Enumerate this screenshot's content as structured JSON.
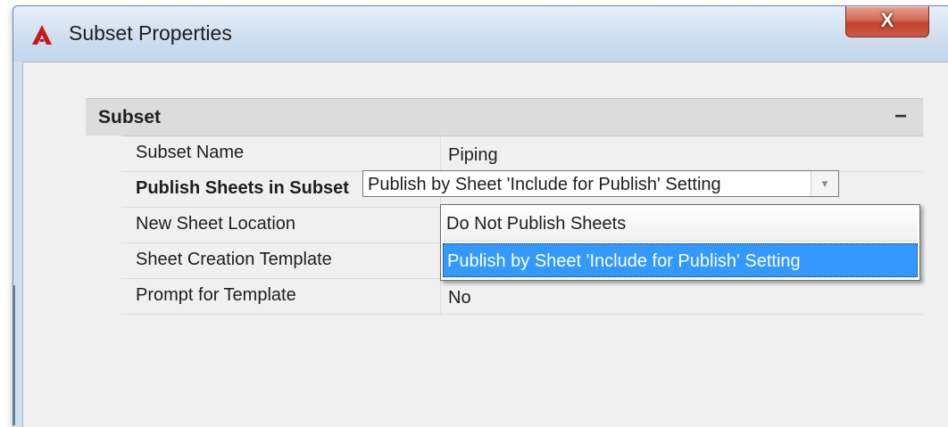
{
  "window": {
    "title": "Subset Properties",
    "app_icon": "autocad-a-icon",
    "close_label": "X"
  },
  "grid": {
    "category": "Subset",
    "collapse_symbol": "−",
    "properties": [
      {
        "name": "Subset Name",
        "value": "Piping"
      },
      {
        "name": "Publish Sheets in Subset",
        "value": "Publish by Sheet 'Include for Publish' Setting"
      },
      {
        "name": "New Sheet Location",
        "value": ""
      },
      {
        "name": "Sheet Creation Template",
        "value": ""
      },
      {
        "name": "Prompt for Template",
        "value": "No"
      }
    ]
  },
  "combo": {
    "value": "Publish by Sheet 'Include for Publish' Setting",
    "arrow": "▾",
    "options": [
      "Do Not Publish Sheets",
      "Publish by Sheet 'Include for Publish' Setting"
    ],
    "selected_index": 1
  },
  "colors": {
    "selection": "#3399ff",
    "close_button": "#c2432d",
    "title_bar": "#cfdff0"
  }
}
